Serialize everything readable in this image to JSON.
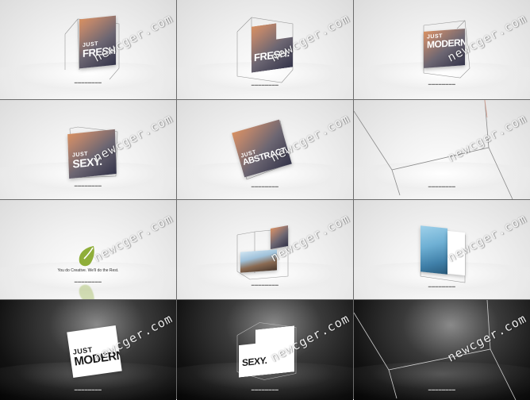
{
  "watermark": "newcger.com",
  "frames": [
    {
      "id": 1,
      "line1": "JUST",
      "line2": "FRESH.",
      "theme": "light"
    },
    {
      "id": 2,
      "line1": "",
      "line2": "FRESH.",
      "theme": "light"
    },
    {
      "id": 3,
      "line1": "JUST",
      "line2": "MODERN.",
      "theme": "light"
    },
    {
      "id": 4,
      "line1": "JUST",
      "line2": "SEXY.",
      "theme": "light"
    },
    {
      "id": 5,
      "line1": "JUST",
      "line2": "ABSTRACT.",
      "theme": "light"
    },
    {
      "id": 6,
      "theme": "light"
    },
    {
      "id": 7,
      "tagline": "You do Creative. We'll do the Rest.",
      "theme": "light"
    },
    {
      "id": 8,
      "theme": "light"
    },
    {
      "id": 9,
      "theme": "light"
    },
    {
      "id": 10,
      "line1": "JUST",
      "line2": "MODERN",
      "theme": "dark"
    },
    {
      "id": 11,
      "line2": "SEXY.",
      "theme": "dark"
    },
    {
      "id": 12,
      "theme": "dark"
    }
  ],
  "colors": {
    "accent_orange": "#d79060",
    "logo_green": "#8fae3a",
    "dark_bg": "#111111"
  },
  "icons": {
    "logo": "leaf-logo-icon"
  }
}
